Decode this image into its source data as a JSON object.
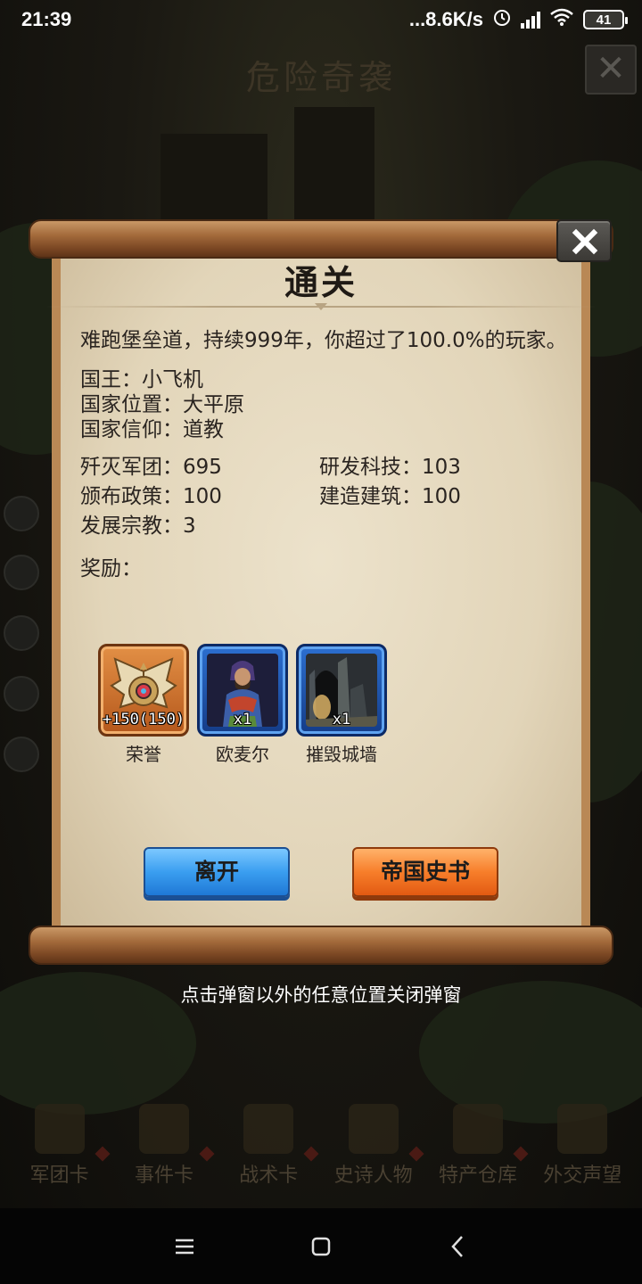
{
  "status_bar": {
    "time": "21:39",
    "network_speed": "...8.6K/s",
    "battery_level": "41"
  },
  "background": {
    "title": "危险奇袭",
    "bottom_tabs": [
      {
        "label": "军团卡",
        "icon": "helmet-icon"
      },
      {
        "label": "事件卡",
        "icon": "scroll-icon"
      },
      {
        "label": "战术卡",
        "icon": "compass-icon"
      },
      {
        "label": "史诗人物",
        "icon": "crown-icon"
      },
      {
        "label": "特产仓库",
        "icon": "chest-icon"
      },
      {
        "label": "外交声望",
        "icon": "letter-icon"
      }
    ]
  },
  "dialog": {
    "title": "通关",
    "summary": "难跑堡垒道，持续999年，你超过了100.0%的玩家。",
    "info": {
      "king": "国王：小飞机",
      "location": "国家位置：大平原",
      "religion": "国家信仰：道教"
    },
    "stats": {
      "armies_destroyed": "歼灭军团：695",
      "tech_researched": "研发科技：103",
      "policies_issued": "颁布政策：100",
      "buildings_built": "建造建筑：100",
      "religions_developed": "发展宗教：3"
    },
    "rewards_label": "奖励：",
    "rewards": [
      {
        "name": "荣誉",
        "count": "+150(150)",
        "frame": "orange",
        "icon": "honor-emblem-icon"
      },
      {
        "name": "欧麦尔",
        "count": "x1",
        "frame": "blue",
        "icon": "character-portrait-icon"
      },
      {
        "name": "摧毁城墙",
        "count": "x1",
        "frame": "blue",
        "icon": "ruined-wall-icon"
      }
    ],
    "buttons": {
      "leave": "离开",
      "history": "帝国史书"
    }
  },
  "dismiss_hint": "点击弹窗以外的任意位置关闭弹窗",
  "colors": {
    "leave_button": "#3a9ef0",
    "history_button": "#f77e2a",
    "paper": "#e6dac0",
    "scroll_wood": "#a36a3b"
  }
}
